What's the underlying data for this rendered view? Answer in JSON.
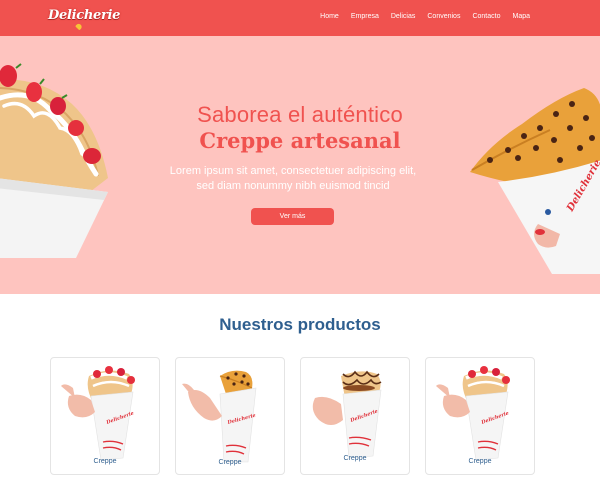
{
  "brand": {
    "logo_text": "Delicherie"
  },
  "nav": {
    "items": [
      "Home",
      "Empresa",
      "Delicias",
      "Convenios",
      "Contacto",
      "Mapa"
    ]
  },
  "hero": {
    "line1": "Saborea el auténtico",
    "line2": "Creppe artesanal",
    "lorem_line1": "Lorem ipsum sit amet, consectetuer adipiscing elit,",
    "lorem_line2": "sed diam nonummy nibh euismod tincid",
    "button": "Ver más"
  },
  "products": {
    "title": "Nuestros productos",
    "items": [
      {
        "label": "Creppe",
        "image": "strawberry-cream-crepe"
      },
      {
        "label": "Creppe",
        "image": "chocolate-chip-crepe"
      },
      {
        "label": "Creppe",
        "image": "chocolate-drizzle-crepe"
      },
      {
        "label": "Creppe",
        "image": "strawberry-cream-crepe"
      }
    ]
  },
  "colors": {
    "primary": "#f0524f",
    "hero_bg": "#fec4bf",
    "heading_blue": "#2f5f8f",
    "logo_accent": "#f7c437"
  },
  "icons": {
    "logo_heart": "heart-icon"
  }
}
